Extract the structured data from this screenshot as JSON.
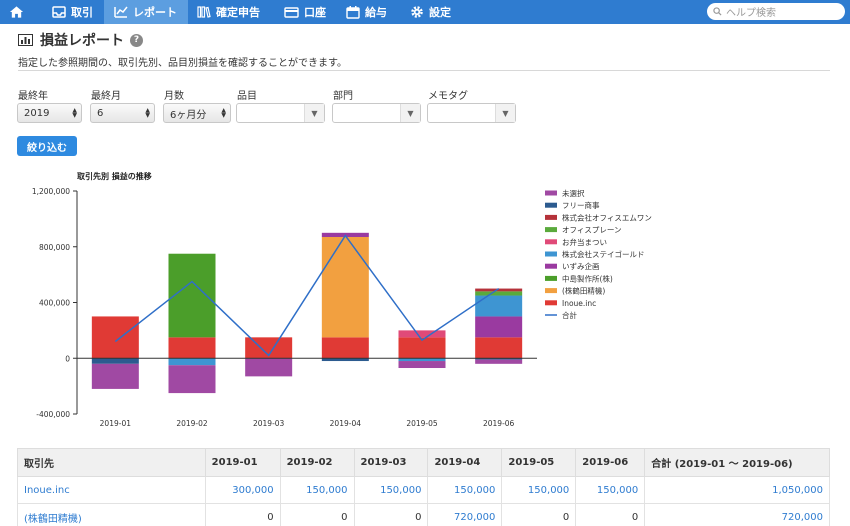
{
  "nav": {
    "items": [
      {
        "label": "取引",
        "icon": "inbox-icon"
      },
      {
        "label": "レポート",
        "icon": "chart-icon"
      },
      {
        "label": "確定申告",
        "icon": "books-icon"
      },
      {
        "label": "口座",
        "icon": "card-icon"
      },
      {
        "label": "給与",
        "icon": "calendar-icon"
      },
      {
        "label": "設定",
        "icon": "gear-icon"
      }
    ],
    "search_placeholder": "ヘルプ検索",
    "colors": {
      "bar": "#2f7cd0",
      "active": "#5c9ee0"
    }
  },
  "page": {
    "title": "損益レポート",
    "help": "?",
    "description": "指定した参照期間の、取引先別、品目別損益を確認することができます。"
  },
  "filters": {
    "year_label": "最終年",
    "year_value": "2019",
    "month_label": "最終月",
    "month_value": "6",
    "months_label": "月数",
    "months_value": "6ヶ月分",
    "item_label": "品目",
    "dept_label": "部門",
    "memo_label": "メモタグ",
    "apply_label": "絞り込む"
  },
  "chart_data": {
    "type": "bar",
    "title": "取引先別 損益の推移",
    "categories": [
      "2019-01",
      "2019-02",
      "2019-03",
      "2019-04",
      "2019-05",
      "2019-06"
    ],
    "ylim": [
      -400000,
      1200000
    ],
    "yticks": [
      "1,200,000",
      "800,000",
      "400,000",
      "0",
      "-400,000"
    ],
    "ytick_values": [
      1200000,
      800000,
      400000,
      0,
      -400000
    ],
    "grid": false,
    "legend_position": "right",
    "series": [
      {
        "name": "未選択",
        "color": "#a049a3",
        "values": [
          -180000,
          -200000,
          -130000,
          0,
          -50000,
          -30000
        ]
      },
      {
        "name": "フリー商事",
        "color": "#2c5b8f",
        "values": [
          -40000,
          0,
          0,
          -20000,
          0,
          -10000
        ]
      },
      {
        "name": "株式会社オフィスエムワン",
        "color": "#b5323a",
        "values": [
          0,
          0,
          0,
          0,
          0,
          20000
        ]
      },
      {
        "name": "オフィスプレーン",
        "color": "#5aaa3c",
        "values": [
          0,
          0,
          0,
          0,
          0,
          30000
        ]
      },
      {
        "name": "お弁当まつい",
        "color": "#e04a78",
        "values": [
          0,
          0,
          0,
          0,
          50000,
          0
        ]
      },
      {
        "name": "株式会社ステイゴールド",
        "color": "#3e95d2",
        "values": [
          0,
          -50000,
          0,
          0,
          -20000,
          150000
        ]
      },
      {
        "name": "いずみ企画",
        "color": "#9a3aa0",
        "values": [
          0,
          0,
          0,
          30000,
          0,
          150000
        ]
      },
      {
        "name": "中島製作所(株)",
        "color": "#4b9e2a",
        "values": [
          0,
          600000,
          0,
          0,
          0,
          0
        ]
      },
      {
        "name": "(株鶴田精機)",
        "color": "#f2a040",
        "values": [
          0,
          0,
          0,
          720000,
          0,
          0
        ]
      },
      {
        "name": "Inoue.inc",
        "color": "#e03a35",
        "values": [
          300000,
          150000,
          150000,
          150000,
          150000,
          150000
        ]
      }
    ],
    "line": {
      "name": "合計",
      "color": "#2f6fc8",
      "values": [
        120000,
        550000,
        20000,
        880000,
        130000,
        500000
      ]
    }
  },
  "table": {
    "headers": [
      "取引先",
      "2019-01",
      "2019-02",
      "2019-03",
      "2019-04",
      "2019-05",
      "2019-06",
      "合計 (2019-01 〜 2019-06)"
    ],
    "rows": [
      [
        "Inoue.inc",
        "300,000",
        "150,000",
        "150,000",
        "150,000",
        "150,000",
        "150,000",
        "1,050,000"
      ],
      [
        "(株鶴田精機)",
        "0",
        "0",
        "0",
        "720,000",
        "0",
        "0",
        "720,000"
      ]
    ]
  }
}
